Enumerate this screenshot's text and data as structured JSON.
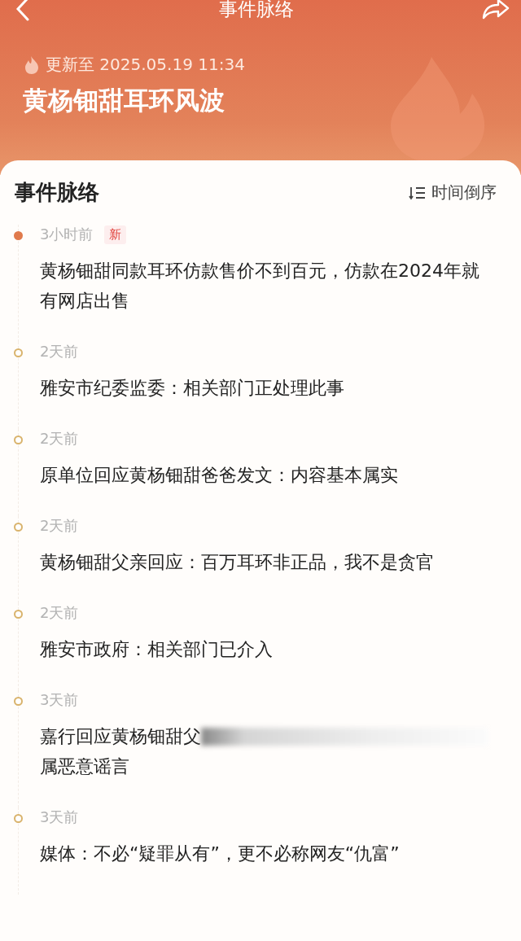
{
  "nav": {
    "title": "事件脉络"
  },
  "header": {
    "updated": "更新至 2025.05.19 11:34",
    "title": "黄杨钿甜耳环风波"
  },
  "section": {
    "title": "事件脉络",
    "sort": "时间倒序"
  },
  "events": [
    {
      "time": "3小时前",
      "badge": "新",
      "latest": true,
      "title": "黄杨钿甜同款耳环仿款售价不到百元，仿款在2024年就有网店出售"
    },
    {
      "time": "2天前",
      "latest": false,
      "title": "雅安市纪委监委：相关部门正处理此事"
    },
    {
      "time": "2天前",
      "latest": false,
      "title": "原单位回应黄杨钿甜爸爸发文：内容基本属实"
    },
    {
      "time": "2天前",
      "latest": false,
      "title": "黄杨钿甜父亲回应：百万耳环非正品，我不是贪官"
    },
    {
      "time": "2天前",
      "latest": false,
      "title": "雅安市政府：相关部门已介入"
    },
    {
      "time": "3天前",
      "latest": false,
      "title": "嘉行回应黄杨钿甜父",
      "redacted": true,
      "continuation": "属恶意谣言"
    },
    {
      "time": "3天前",
      "latest": false,
      "title": "媒体：不必“疑罪从有”，更不必称网友“仇富”"
    }
  ]
}
